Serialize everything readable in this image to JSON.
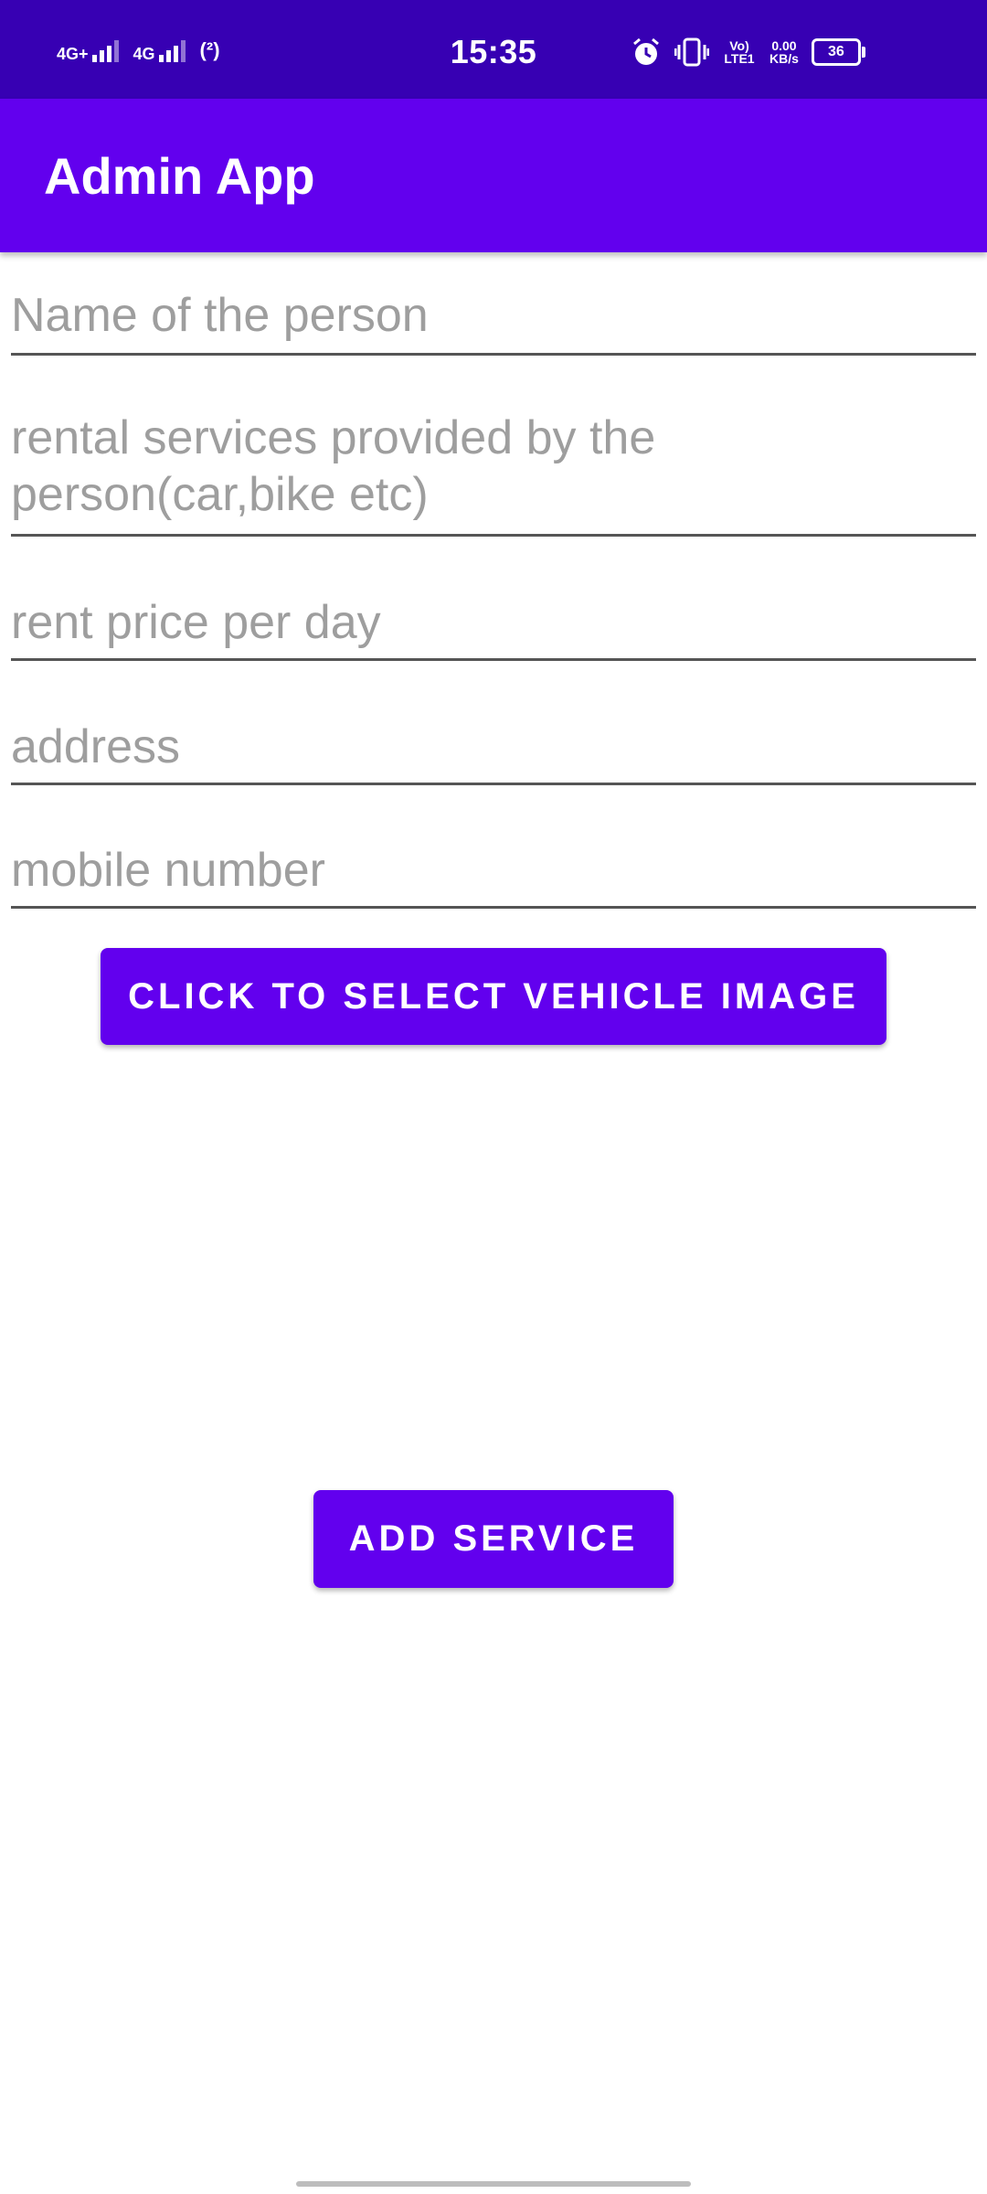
{
  "status_bar": {
    "net1": "4G+",
    "net2": "4G",
    "hotspot": "(²)",
    "time": "15:35",
    "volte": "Vo) LTE1",
    "speed_value": "0.00",
    "speed_unit": "KB/s",
    "battery": "36",
    "icons": [
      "alarm-icon",
      "vibrate-icon",
      "battery-icon"
    ]
  },
  "app_bar": {
    "title": "Admin App"
  },
  "form": {
    "name_placeholder": "Name of the person",
    "rental_placeholder_line1": "rental services provided by the",
    "rental_placeholder_line2": "person(car,bike etc)",
    "price_placeholder": "rent price per day",
    "address_placeholder": "address",
    "mobile_placeholder": "mobile number"
  },
  "buttons": {
    "select_image": "CLICK TO SELECT VEHICLE IMAGE",
    "add_service": "ADD SERVICE"
  },
  "colors": {
    "status_bar": "#3700b3",
    "primary": "#6200ee",
    "hint_text": "#9e9e9e"
  }
}
